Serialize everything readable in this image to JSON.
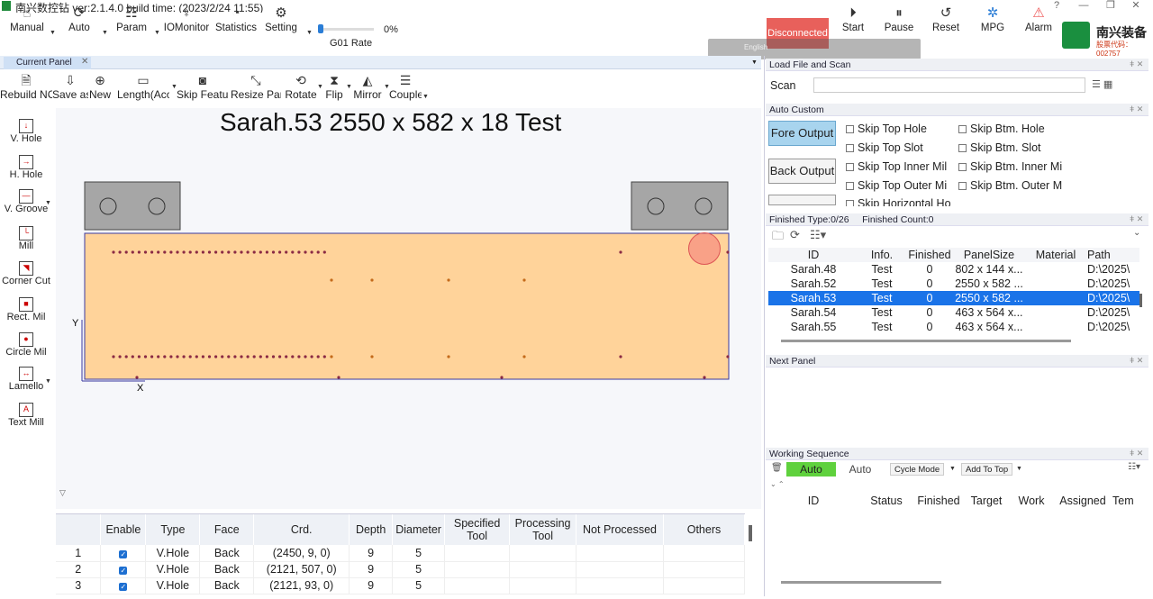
{
  "title": "南兴数控钻 ver:2.1.4.0 build time: (2023/2/24 11:55)",
  "window_controls": [
    "?",
    "—",
    "❐",
    "✕"
  ],
  "toolbar": {
    "manual": "Manual",
    "auto": "Auto",
    "param": "Param",
    "iomonitor": "IOMonitor",
    "statistics": "Statistics",
    "setting": "Setting",
    "rate_label": "G01 Rate",
    "rate_value": "0%",
    "rate_fraction": 0,
    "status": "Disconnected",
    "start": "Start",
    "pause": "Pause",
    "reset": "Reset",
    "mpg": "MPG",
    "alarm": "Alarm",
    "language": "English",
    "brand_name": "南兴装备",
    "brand_code": "股票代码：002757"
  },
  "tabs": {
    "current": "Current Panel",
    "close": "✕"
  },
  "subtools": [
    "Rebuild NC",
    "Save as",
    "New",
    "Length(Acc.",
    "Skip Feature",
    "Resize Panel",
    "Rotate",
    "Flip",
    "Mirror",
    "Couple"
  ],
  "lefttools": [
    "V. Hole",
    "H. Hole",
    "V. Groove",
    "Mill",
    "Corner Cut",
    "Rect. Mil",
    "Circle Mil",
    "Lamello",
    "Text Mill"
  ],
  "panel_title": "Sarah.53  2550 x 582 x 18 Test",
  "axis": {
    "y": "Y",
    "x": "X"
  },
  "features": {
    "columns": [
      "",
      "Enable",
      "Type",
      "Face",
      "Crd.",
      "Depth",
      "Diameter",
      "Specified Tool",
      "Processing Tool",
      "Not Processed",
      "Others"
    ],
    "rows": [
      {
        "n": "1",
        "type": "V.Hole",
        "face": "Back",
        "crd": "(2450, 9, 0)",
        "depth": "9",
        "dia": "5"
      },
      {
        "n": "2",
        "type": "V.Hole",
        "face": "Back",
        "crd": "(2121, 507, 0)",
        "depth": "9",
        "dia": "5"
      },
      {
        "n": "3",
        "type": "V.Hole",
        "face": "Back",
        "crd": "(2121, 93, 0)",
        "depth": "9",
        "dia": "5"
      }
    ]
  },
  "load_scan": {
    "title": "Load File and Scan",
    "scan_label": "Scan"
  },
  "auto_custom": {
    "title": "Auto Custom",
    "fore_output": "Fore Output",
    "back_output": "Back Output",
    "checks_left": [
      "Skip Top Hole",
      "Skip Top Slot",
      "Skip Top Inner Mil",
      "Skip Top Outer Mi",
      "Skip Horizontal Ho"
    ],
    "checks_right": [
      "Skip Btm. Hole",
      "Skip Btm. Slot",
      "Skip Btm. Inner Mi",
      "Skip Btm. Outer M"
    ]
  },
  "finished": {
    "type_label": "Finished Type:0/26",
    "count_label": "Finished Count:0",
    "columns": [
      "ID",
      "Info.",
      "Finished",
      "PanelSize",
      "Material",
      "Path"
    ],
    "rows": [
      {
        "id": "Sarah.48",
        "info": "Test",
        "fin": "0",
        "size": "802 x 144 x...",
        "mat": "",
        "path": "D:\\2025\\",
        "sel": false
      },
      {
        "id": "Sarah.52",
        "info": "Test",
        "fin": "0",
        "size": "2550 x 582 ...",
        "mat": "",
        "path": "D:\\2025\\",
        "sel": false
      },
      {
        "id": "Sarah.53",
        "info": "Test",
        "fin": "0",
        "size": "2550 x 582 ...",
        "mat": "",
        "path": "D:\\2025\\",
        "sel": true
      },
      {
        "id": "Sarah.54",
        "info": "Test",
        "fin": "0",
        "size": "463 x 564 x...",
        "mat": "",
        "path": "D:\\2025\\",
        "sel": false
      },
      {
        "id": "Sarah.55",
        "info": "Test",
        "fin": "0",
        "size": "463 x 564 x...",
        "mat": "",
        "path": "D:\\2025\\",
        "sel": false
      }
    ]
  },
  "next_panel": {
    "title": "Next Panel"
  },
  "working_sequence": {
    "title": "Working Sequence",
    "tab_auto_active": "Auto",
    "tab_auto": "Auto",
    "cycle_mode": "Cycle Mode",
    "add_to_top": "Add To Top",
    "columns": [
      "ID",
      "Status",
      "Finished",
      "Target",
      "Work",
      "Assigned",
      "Tem"
    ]
  },
  "colors": {
    "panel_fill": "#ffd39a",
    "selected_row": "#1a73e8",
    "fore_output": "#a8d4ee",
    "auto_tab": "#5fd13d",
    "disconnected": "#e8605b"
  }
}
